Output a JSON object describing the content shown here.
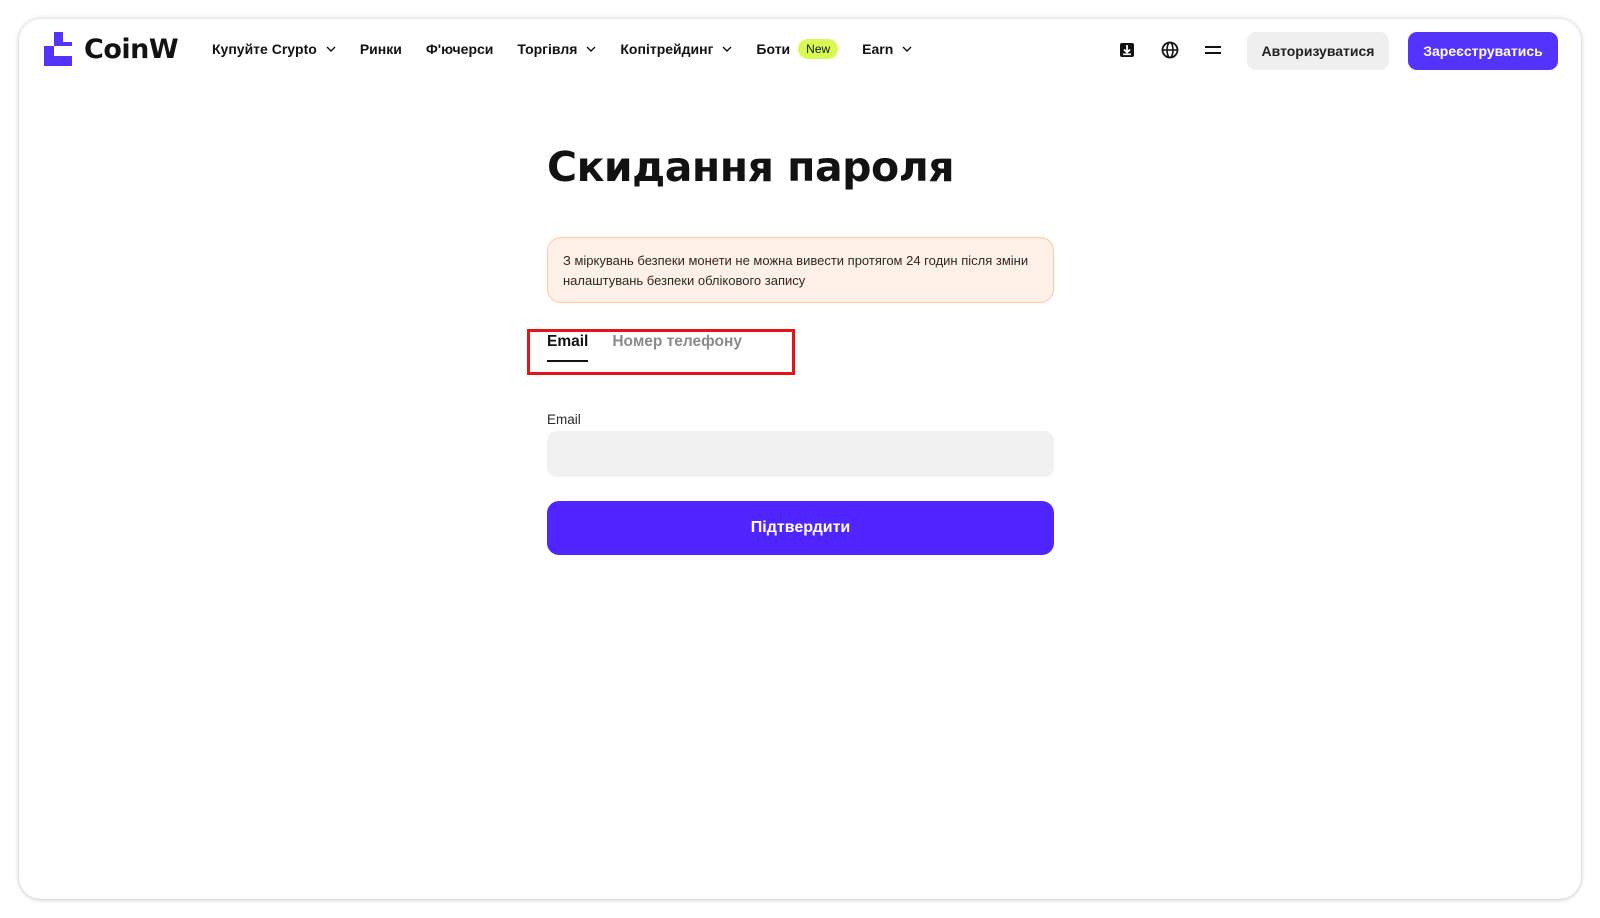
{
  "brand": {
    "name": "CoinW",
    "accent": "#5533ff"
  },
  "nav": {
    "items": [
      {
        "label": "Купуйте Crypto",
        "dropdown": true
      },
      {
        "label": "Ринки",
        "dropdown": false
      },
      {
        "label": "Ф'ючерси",
        "dropdown": false
      },
      {
        "label": "Торгівля",
        "dropdown": true
      },
      {
        "label": "Копітрейдинг",
        "dropdown": true
      },
      {
        "label": "Боти",
        "badge": "New",
        "dropdown": false
      },
      {
        "label": "Earn",
        "dropdown": true
      }
    ]
  },
  "header": {
    "icons": [
      "download-icon",
      "globe-icon",
      "menu-icon"
    ],
    "login_label": "Авторизуватися",
    "register_label": "Зареєструватись"
  },
  "form": {
    "title": "Скидання пароля",
    "notice": "З міркувань безпеки монети не можна вивести протягом 24 годин після зміни налаштувань безпеки облікового запису",
    "tabs": [
      {
        "label": "Email",
        "active": true
      },
      {
        "label": "Номер телефону",
        "active": false
      }
    ],
    "email_label": "Email",
    "email_value": "",
    "email_placeholder": "",
    "submit_label": "Підтвердити"
  }
}
